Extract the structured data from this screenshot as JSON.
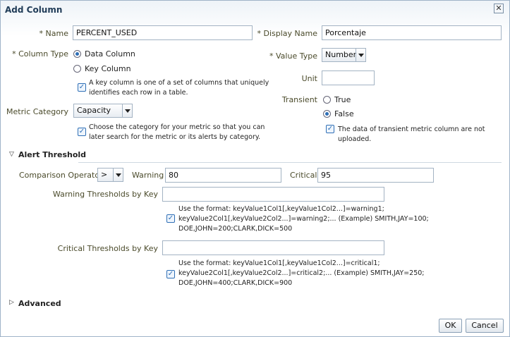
{
  "dialog": {
    "title": "Add Column",
    "close_glyph": "✕"
  },
  "left": {
    "name_label": "Name",
    "name_value": "PERCENT_USED",
    "column_type_label": "Column Type",
    "column_type_options": [
      "Data Column",
      "Key Column"
    ],
    "column_type_selected": "Data Column",
    "key_column_hint": [
      "A key column is one of a set of columns that uniquely",
      "identifies each row in a table."
    ],
    "metric_category_label": "Metric Category",
    "metric_category_value": "Capacity",
    "metric_category_hint": [
      "Choose the category for your metric so that you can",
      "later search for the metric or its alerts by category."
    ]
  },
  "right": {
    "display_name_label": "Display Name",
    "display_name_value": "Porcentaje",
    "value_type_label": "Value Type",
    "value_type_value": "Number",
    "unit_label": "Unit",
    "unit_value": "",
    "transient_label": "Transient",
    "transient_options": [
      "True",
      "False"
    ],
    "transient_selected": "False",
    "transient_hint": "The data of transient metric column are not uploaded."
  },
  "alert": {
    "section_label": "Alert Threshold",
    "comparison_label": "Comparison Operator",
    "comparison_value": ">",
    "warning_label": "Warning",
    "warning_value": "80",
    "critical_label": "Critical",
    "critical_value": "95",
    "warning_by_key_label": "Warning Thresholds by Key",
    "warning_by_key_value": "",
    "warning_hint": [
      "Use the format: keyValue1Col1[,keyValue1Col2...]=warning1;",
      "keyValue2Col1[,keyValue2Col2...]=warning2;... (Example) SMITH,JAY=100;",
      "DOE,JOHN=200;CLARK,DICK=500"
    ],
    "critical_by_key_label": "Critical Thresholds by Key",
    "critical_by_key_value": "",
    "critical_hint": [
      "Use the format: keyValue1Col1[,keyValue1Col2...]=critical1;",
      "keyValue2Col1[,keyValue2Col2...]=critical2;... (Example) SMITH,JAY=250;",
      "DOE,JOHN=400;CLARK,DICK=900"
    ]
  },
  "advanced": {
    "section_label": "Advanced"
  },
  "footer": {
    "ok_label": "OK",
    "cancel_label": "Cancel"
  },
  "icons": {
    "required_marker": "*",
    "check": "✓",
    "expanded": "▽",
    "collapsed": "▷"
  }
}
